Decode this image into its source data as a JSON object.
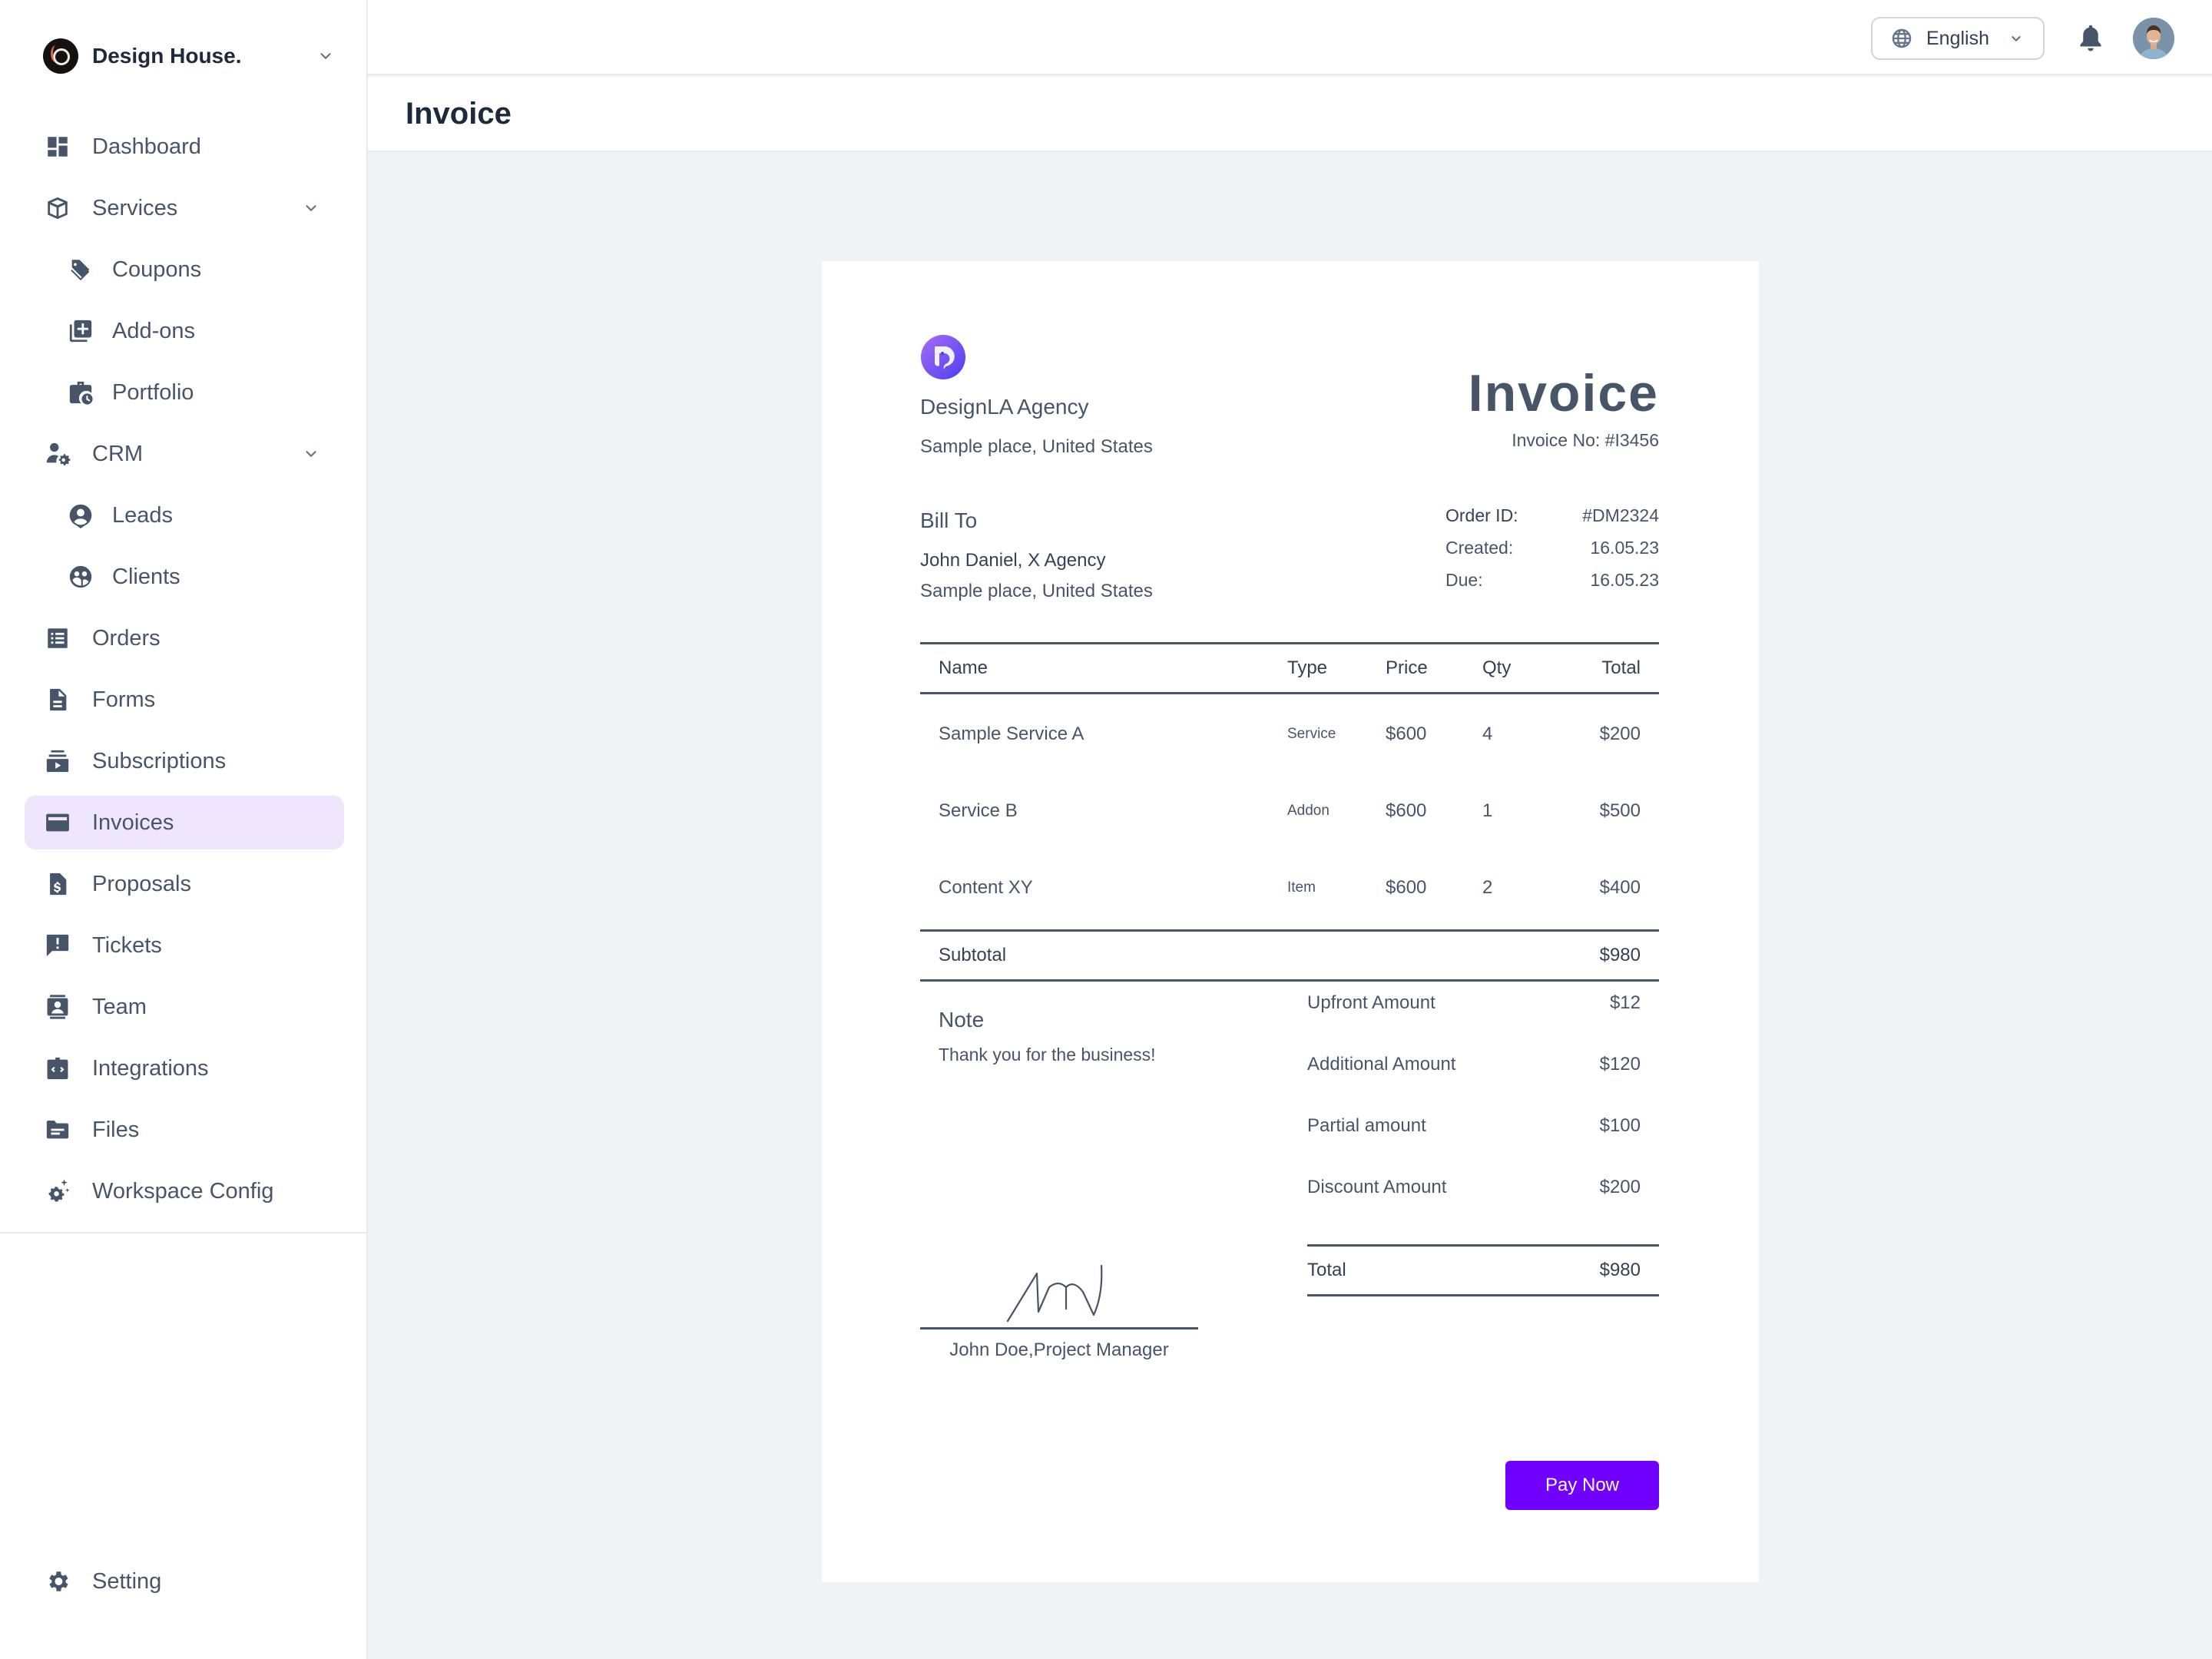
{
  "brand": {
    "name": "Design House."
  },
  "topbar": {
    "language": "English"
  },
  "page": {
    "title": "Invoice"
  },
  "sidebar": {
    "items": [
      {
        "label": "Dashboard",
        "icon": "dashboard-icon"
      },
      {
        "label": "Services",
        "icon": "box-icon",
        "expandable": true
      },
      {
        "label": "Coupons",
        "icon": "tag-icon",
        "sub": true
      },
      {
        "label": "Add-ons",
        "icon": "add-box-icon",
        "sub": true
      },
      {
        "label": "Portfolio",
        "icon": "briefcase-clock-icon",
        "sub": true
      },
      {
        "label": "CRM",
        "icon": "user-gear-icon",
        "expandable": true
      },
      {
        "label": "Leads",
        "icon": "user-pin-icon",
        "sub": true
      },
      {
        "label": "Clients",
        "icon": "group-circle-icon",
        "sub": true
      },
      {
        "label": "Orders",
        "icon": "list-icon"
      },
      {
        "label": "Forms",
        "icon": "document-icon"
      },
      {
        "label": "Subscriptions",
        "icon": "subscriptions-icon"
      },
      {
        "label": "Invoices",
        "icon": "card-icon",
        "active": true
      },
      {
        "label": "Proposals",
        "icon": "document-dollar-icon"
      },
      {
        "label": "Tickets",
        "icon": "feedback-icon"
      },
      {
        "label": "Team",
        "icon": "contact-card-icon"
      },
      {
        "label": "Integrations",
        "icon": "code-clipboard-icon"
      },
      {
        "label": "Files",
        "icon": "folder-icon"
      },
      {
        "label": "Workspace Config",
        "icon": "gear-sparkle-icon"
      }
    ],
    "footer": {
      "label": "Setting",
      "icon": "gear-icon"
    }
  },
  "invoice": {
    "from": {
      "name": "DesignLA Agency",
      "address": "Sample place, United States"
    },
    "title": "Invoice",
    "number": "Invoice No: #I3456",
    "bill_to": {
      "heading": "Bill To",
      "name": "John Daniel, X Agency",
      "address": "Sample place, United States"
    },
    "meta": [
      {
        "label": "Order ID:",
        "value": "#DM2324"
      },
      {
        "label": "Created:",
        "value": "16.05.23"
      },
      {
        "label": "Due:",
        "value": "16.05.23"
      }
    ],
    "columns": [
      "Name",
      "Type",
      "Price",
      "Qty",
      "Total"
    ],
    "items": [
      {
        "name": "Sample Service A",
        "type": "Service",
        "price": "$600",
        "qty": "4",
        "total": "$200"
      },
      {
        "name": "Service B",
        "type": "Addon",
        "price": "$600",
        "qty": "1",
        "total": "$500"
      },
      {
        "name": "Content XY",
        "type": "Item",
        "price": "$600",
        "qty": "2",
        "total": "$400"
      }
    ],
    "subtotal": {
      "label": "Subtotal",
      "value": "$980"
    },
    "note": {
      "heading": "Note",
      "text": "Thank you for the business!"
    },
    "summary": [
      {
        "label": "Upfront Amount",
        "value": "$12"
      },
      {
        "label": "Additional Amount",
        "value": "$120"
      },
      {
        "label": "Partial amount",
        "value": "$100"
      },
      {
        "label": "Discount Amount",
        "value": "$200"
      }
    ],
    "total": {
      "label": "Total",
      "value": "$980"
    },
    "signature": {
      "name": "John Doe,Project Manager"
    },
    "pay_button": "Pay Now"
  },
  "colors": {
    "accent": "#7000ff",
    "active_bg": "#efe6fd",
    "text": "#475569"
  }
}
